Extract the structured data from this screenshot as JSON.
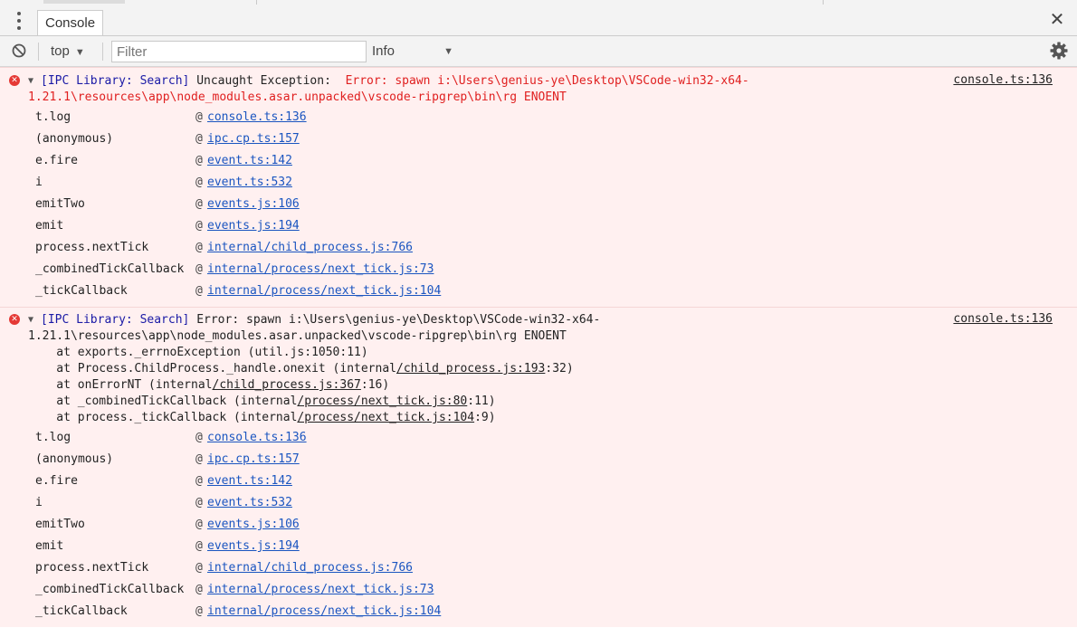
{
  "tab": {
    "label": "Console"
  },
  "toolbar": {
    "context": "top",
    "filter_placeholder": "Filter",
    "level": "Info"
  },
  "msg1": {
    "prefix": "[IPC Library: Search]",
    "text": " Uncaught Exception:  ",
    "error_part1": "Error: spawn i:\\Users\\genius-ye\\Desktop\\VSCode-win32-x64-",
    "error_part2": "1.21.1\\resources\\app\\node_modules.asar.unpacked\\vscode-ripgrep\\bin\\rg ENOENT",
    "source": "console.ts:136",
    "frames": [
      {
        "fn": "t.log",
        "link": "console.ts:136"
      },
      {
        "fn": "(anonymous)",
        "link": "ipc.cp.ts:157"
      },
      {
        "fn": "e.fire",
        "link": "event.ts:142"
      },
      {
        "fn": "i",
        "link": "event.ts:532"
      },
      {
        "fn": "emitTwo",
        "link": "events.js:106"
      },
      {
        "fn": "emit",
        "link": "events.js:194"
      },
      {
        "fn": "process.nextTick",
        "link": "internal/child_process.js:766"
      },
      {
        "fn": "_combinedTickCallback",
        "link": "internal/process/next_tick.js:73"
      },
      {
        "fn": "_tickCallback",
        "link": "internal/process/next_tick.js:104"
      }
    ]
  },
  "msg2": {
    "prefix": "[IPC Library: Search]",
    "text": " Error: spawn i:\\Users\\genius-ye\\Desktop\\VSCode-win32-x64-",
    "line2": "1.21.1\\resources\\app\\node_modules.asar.unpacked\\vscode-ripgrep\\bin\\rg ENOENT",
    "source": "console.ts:136",
    "stack": [
      {
        "pre": "    at exports._errnoException (util.js:1050:11)",
        "link": "",
        "post": ""
      },
      {
        "pre": "    at Process.ChildProcess._handle.onexit (internal",
        "link": "/child_process.js:193",
        "post": ":32)"
      },
      {
        "pre": "    at onErrorNT (internal",
        "link": "/child_process.js:367",
        "post": ":16)"
      },
      {
        "pre": "    at _combinedTickCallback (internal",
        "link": "/process/next_tick.js:80",
        "post": ":11)"
      },
      {
        "pre": "    at process._tickCallback (internal",
        "link": "/process/next_tick.js:104",
        "post": ":9)"
      }
    ],
    "frames": [
      {
        "fn": "t.log",
        "link": "console.ts:136"
      },
      {
        "fn": "(anonymous)",
        "link": "ipc.cp.ts:157"
      },
      {
        "fn": "e.fire",
        "link": "event.ts:142"
      },
      {
        "fn": "i",
        "link": "event.ts:532"
      },
      {
        "fn": "emitTwo",
        "link": "events.js:106"
      },
      {
        "fn": "emit",
        "link": "events.js:194"
      },
      {
        "fn": "process.nextTick",
        "link": "internal/child_process.js:766"
      },
      {
        "fn": "_combinedTickCallback",
        "link": "internal/process/next_tick.js:73"
      },
      {
        "fn": "_tickCallback",
        "link": "internal/process/next_tick.js:104"
      }
    ]
  },
  "frame_at": "@",
  "icons": {
    "menu": "kebab-menu-icon",
    "close": "close-icon",
    "clear": "clear-console-icon",
    "settings": "gear-icon",
    "error": "error-icon",
    "expand": "triangle-down-icon"
  },
  "colors": {
    "error_bg": "#fff0f0",
    "error_text": "#e02020",
    "prefix_blue": "#1a1aa6",
    "link_blue": "#1a55c0"
  }
}
